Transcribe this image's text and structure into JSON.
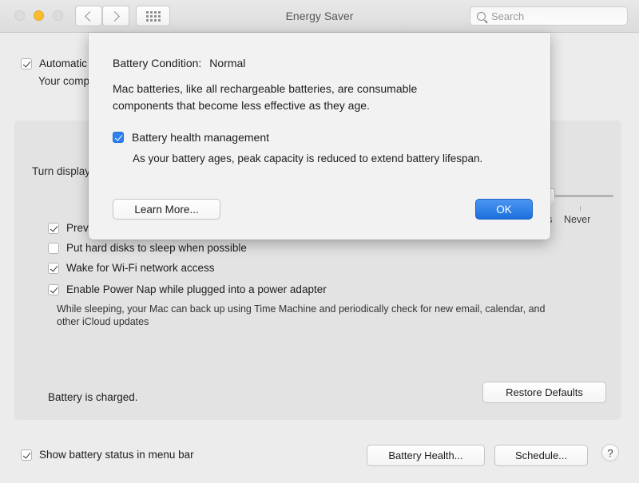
{
  "window": {
    "title": "Energy Saver",
    "traffic_lights": [
      "close",
      "minimize",
      "zoom"
    ],
    "nav_back": "back-chevron",
    "nav_forward": "forward-chevron",
    "grid_button": "show-all-icon",
    "search": {
      "placeholder": "Search",
      "value": ""
    }
  },
  "prefs": {
    "auto_graphics": {
      "label": "Automatic graphics switching",
      "desc": "Your computer will automatically switch graphics modes to maximize battery life.",
      "checked": true
    },
    "turn_display_off": "Turn display off after:",
    "slider": {
      "value_label": "Never",
      "left_label": "hrs",
      "right_label": "Never",
      "position_pct": 88
    },
    "options": [
      {
        "label": "Prevent computer from sleeping automatically when the display is off",
        "checked": true
      },
      {
        "label": "Put hard disks to sleep when possible",
        "checked": false
      },
      {
        "label": "Wake for Wi-Fi network access",
        "checked": true
      },
      {
        "label": "Enable Power Nap while plugged into a power adapter",
        "checked": true
      }
    ],
    "power_nap_desc": "While sleeping, your Mac can back up using Time Machine and periodically check for new email, calendar, and other iCloud updates",
    "battery_status": "Battery is charged.",
    "restore_defaults": "Restore Defaults",
    "show_battery_status": {
      "label": "Show battery status in menu bar",
      "checked": true
    },
    "battery_health_button": "Battery Health...",
    "schedule_button": "Schedule...",
    "help_button": "?"
  },
  "sheet": {
    "condition_label": "Battery Condition:",
    "condition_value": "Normal",
    "paragraph": "Mac batteries, like all rechargeable batteries, are consumable components that become less effective as they age.",
    "bhm_label": "Battery health management",
    "bhm_checked": true,
    "bhm_desc": "As your battery ages, peak capacity is reduced to extend battery lifespan.",
    "learn_more": "Learn More...",
    "ok": "OK"
  },
  "colors": {
    "accent_blue": "#2f7ff0",
    "ok_button_top": "#4a96f2",
    "ok_button_bottom": "#1c6fdc",
    "minimize_yellow": "#fdbc2e",
    "window_bg": "#ececec",
    "panel_bg": "#e3e3e3",
    "sheet_bg": "#f2f2f2"
  }
}
